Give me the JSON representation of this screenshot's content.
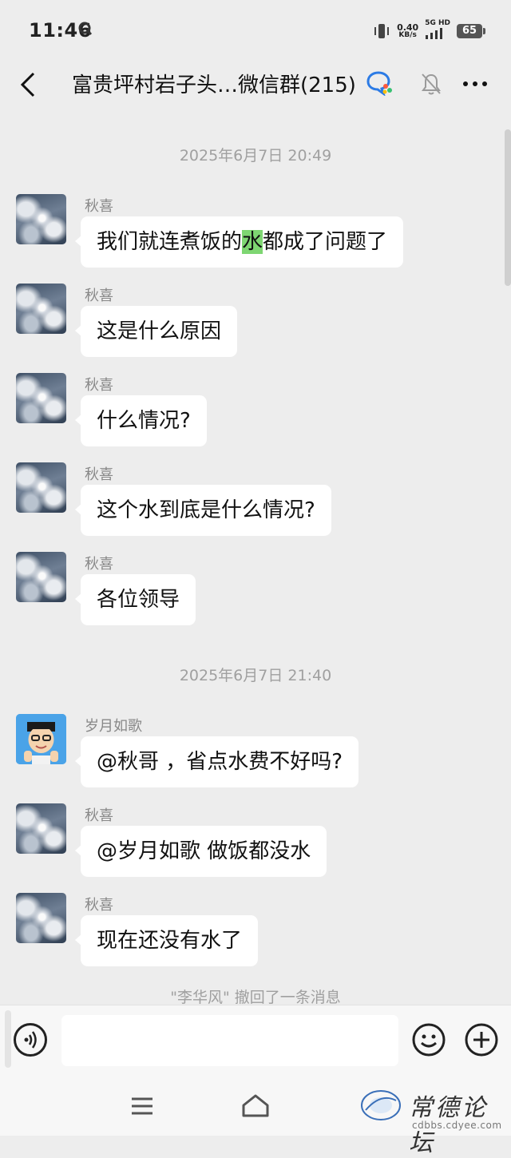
{
  "status_bar": {
    "time": "11:46",
    "net_speed": "0.40",
    "net_speed_unit": "KB/s",
    "network": "5G HD",
    "battery": "65"
  },
  "header": {
    "title": "富贵坪村岩子头…微信群(215)"
  },
  "timestamps": [
    "2025年6月7日 20:49",
    "2025年6月7日 21:40"
  ],
  "messages": [
    {
      "sender": "秋喜",
      "text_before": "我们就连煮饭的",
      "highlight": "水",
      "text_after": "都成了问题了"
    },
    {
      "sender": "秋喜",
      "text": "这是什么原因"
    },
    {
      "sender": "秋喜",
      "text": "什么情况?"
    },
    {
      "sender": "秋喜",
      "text": "这个水到底是什么情况?"
    },
    {
      "sender": "秋喜",
      "text": "各位领导"
    },
    {
      "sender": "岁月如歌",
      "text": "@秋哥 ，省点水费不好吗?"
    },
    {
      "sender": "秋喜",
      "text": "@岁月如歌  做饭都没水"
    },
    {
      "sender": "秋喜",
      "text": "现在还没有水了"
    }
  ],
  "recall_note": "\"李华风\" 撤回了一条消息",
  "input": {
    "placeholder": ""
  },
  "watermark": {
    "title": "常德论坛",
    "url": "cdbbs.cdyee.com"
  },
  "colors": {
    "highlight": "#7ed672",
    "background": "#ededed",
    "bubble": "#ffffff"
  }
}
